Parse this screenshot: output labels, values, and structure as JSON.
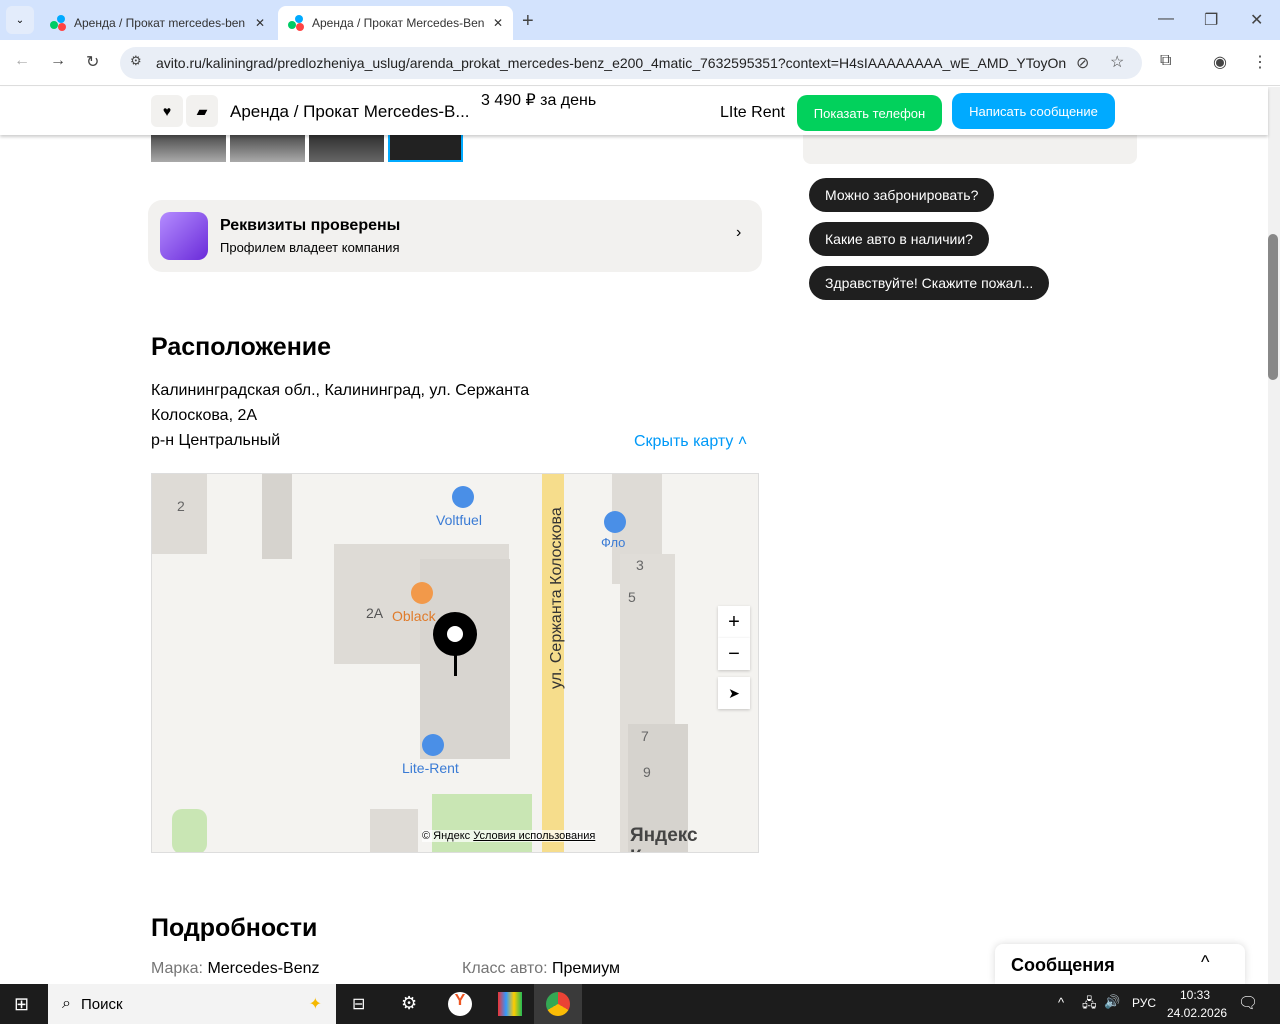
{
  "browser": {
    "tabs": [
      {
        "title": "Аренда / Прокат mercedes-ben"
      },
      {
        "title": "Аренда / Прокат Mercedes-Ben"
      }
    ],
    "url": "avito.ru/kaliningrad/predlozheniya_uslug/arenda_prokat_mercedes-benz_e200_4matic_7632595351?context=H4sIAAAAAAAA_wE_AMD_YToyOntz..."
  },
  "sticky": {
    "title": "Аренда / Прокат Mercedes-B...",
    "price": "3 490 ₽ за день",
    "seller": "LIte Rent",
    "show_phone": "Показать телефон",
    "write_message": "Написать сообщение"
  },
  "verified": {
    "title": "Реквизиты проверены",
    "subtitle": "Профилем владеет компания"
  },
  "chips": [
    "Можно забронировать?",
    "Какие авто в наличии?",
    "Здравствуйте! Скажите пожал..."
  ],
  "location": {
    "heading": "Расположение",
    "address_line1": "Калининградская обл., Калининград, ул. Сержанта",
    "address_line2": "Колоскова, 2А",
    "district": "р-н Центральный",
    "hide_map": "Скрыть карту"
  },
  "map": {
    "labels": {
      "street": "ул. Сержанта Колоскова",
      "voltfuel": "Voltfuel",
      "flo": "Фло",
      "oblack": "Oblack",
      "building_2a": "2A",
      "lite_rent": "Lite-Rent",
      "n2": "2",
      "n3": "3",
      "n5": "5",
      "n7": "7",
      "n9": "9"
    },
    "copyright": "© Яндекс",
    "terms": "Условия использования",
    "logo": "Яндекс Карты"
  },
  "details": {
    "heading": "Подробности",
    "brand_label": "Марка:",
    "brand": "Mercedes-Benz",
    "class_label": "Класс авто:",
    "class": "Премиум"
  },
  "messages": {
    "title": "Сообщения"
  },
  "taskbar": {
    "search": "Поиск",
    "lang": "РУС",
    "time": "10:33",
    "date": "24.02.2026"
  }
}
